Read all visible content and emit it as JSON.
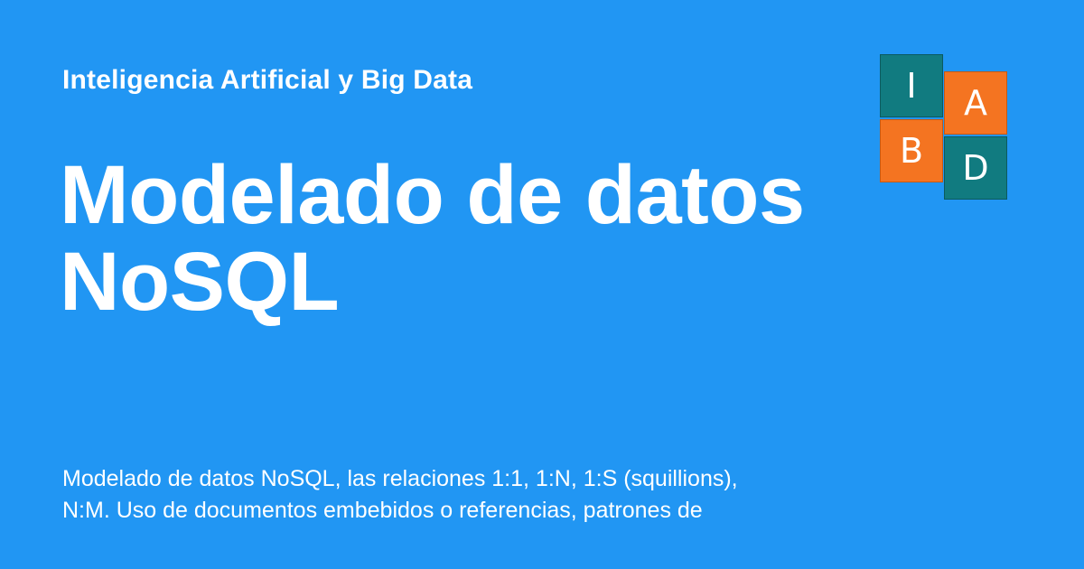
{
  "site": {
    "name": "Inteligencia Artificial y Big Data"
  },
  "title": {
    "line1": "Modelado de datos",
    "line2": "NoSQL"
  },
  "description": {
    "line1": "Modelado de datos NoSQL, las relaciones 1:1, 1:N, 1:S (squillions),",
    "line2": "N:M. Uso de documentos embebidos o referencias, patrones de"
  },
  "logo": {
    "tiles": [
      "I",
      "A",
      "B",
      "D"
    ],
    "colors": {
      "teal": "#117b80",
      "orange": "#f47421"
    }
  },
  "colors": {
    "background": "#2196f3",
    "text": "#ffffff"
  }
}
